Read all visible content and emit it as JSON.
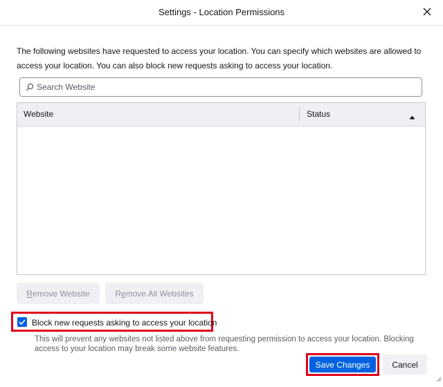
{
  "window": {
    "title": "Settings - Location Permissions"
  },
  "description": "The following websites have requested to access your location. You can specify which websites are allowed to access your location. You can also block new requests asking to access your location.",
  "search": {
    "placeholder": "Search Website",
    "value": ""
  },
  "table": {
    "columns": [
      "Website",
      "Status"
    ],
    "sort_column": "Status",
    "sort_direction": "ascending",
    "rows": []
  },
  "buttons": {
    "remove_website": {
      "prefix": "",
      "accesskey": "R",
      "rest": "emove Website"
    },
    "remove_all": {
      "prefix": "R",
      "accesskey": "e",
      "rest": "move All Websites"
    },
    "save_changes": "Save Changes",
    "cancel": "Cancel"
  },
  "block_checkbox": {
    "label": "Block new requests asking to access your location",
    "checked": true
  },
  "block_note": "This will prevent any websites not listed above from requesting permission to access your location. Blocking access to your location may break some website features.",
  "icons": {
    "close": "close-icon",
    "search": "search-icon",
    "sort": "sort-ascending-icon",
    "check": "checkmark-icon",
    "resize": "resize-grip-icon"
  },
  "colors": {
    "accent": "#0061e0",
    "highlight": "#e0001b",
    "button_bg": "#f0f0f4",
    "disabled_text": "#8f8f9d"
  }
}
